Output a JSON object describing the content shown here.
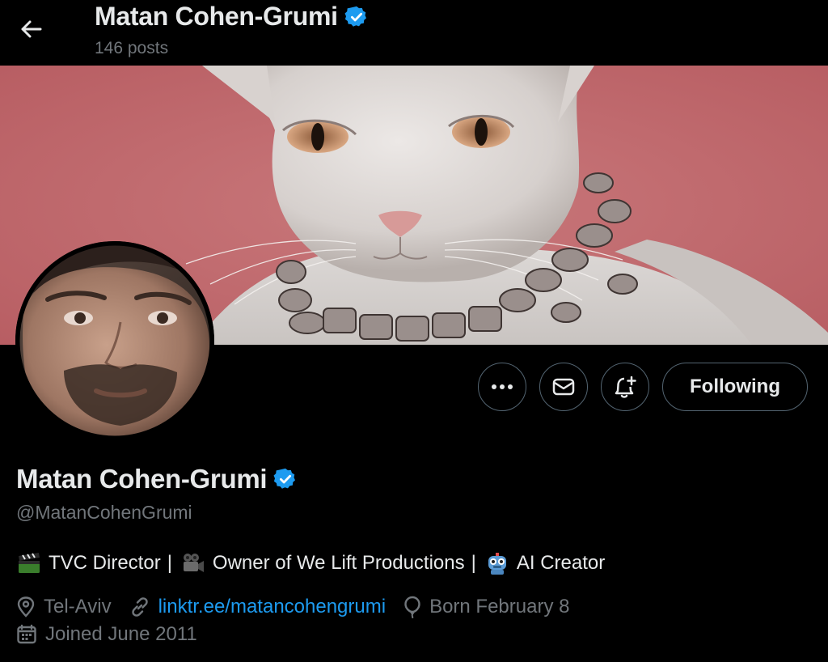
{
  "header": {
    "name": "Matan Cohen-Grumi",
    "post_count": "146 posts"
  },
  "profile": {
    "name": "Matan Cohen-Grumi",
    "handle": "@MatanCohenGrumi",
    "bio": {
      "part1": "TVC Director",
      "part2": "Owner of We Lift Productions",
      "part3": "AI Creator",
      "separator": "|"
    },
    "location": "Tel-Aviv",
    "website": "linktr.ee/matancohengrumi",
    "birthday": "Born February 8",
    "joined": "Joined June 2011"
  },
  "actions": {
    "following_label": "Following"
  },
  "colors": {
    "background": "#000000",
    "text_primary": "#e7e9ea",
    "text_secondary": "#71767b",
    "link": "#1d9bf0",
    "verified": "#1d9bf0",
    "button_border": "#536471",
    "banner_bg": "#c46a6e"
  },
  "icons": {
    "back": "arrow-left-icon",
    "verified": "verified-badge-icon",
    "more": "more-dots-icon",
    "message": "mail-icon",
    "notify": "bell-plus-icon",
    "location": "location-pin-icon",
    "link": "link-icon",
    "birthday": "balloon-icon",
    "joined": "calendar-icon"
  }
}
